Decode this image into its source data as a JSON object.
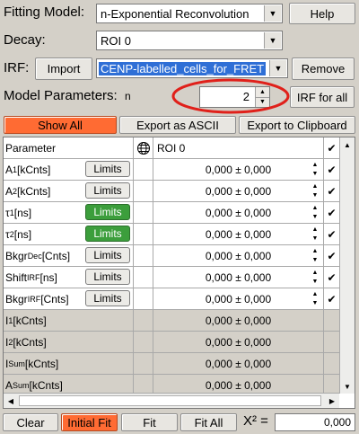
{
  "fitting_model": {
    "label": "Fitting Model:",
    "value": "n-Exponential Reconvolution",
    "help": "Help"
  },
  "decay": {
    "label": "Decay:",
    "value": "ROI 0"
  },
  "irf": {
    "label": "IRF:",
    "import": "Import",
    "value": "CENP-labelled_cells_for_FRET",
    "remove": "Remove"
  },
  "model_params": {
    "label": "Model Parameters:",
    "n_label": "n",
    "n_value": "2",
    "irf_for_all": "IRF for all"
  },
  "toolbar": {
    "show_all": "Show All",
    "export_ascii": "Export as ASCII",
    "export_clipboard": "Export to Clipboard"
  },
  "table": {
    "header_param": "Parameter",
    "header_roi": "ROI 0",
    "header_check": "✔",
    "rows": [
      {
        "name": "A",
        "sub": "1",
        "unit": "[kCnts]",
        "limits": "Limits",
        "limits_active": false,
        "value": "0,000 ± 0,000",
        "editable": true
      },
      {
        "name": "A",
        "sub": "2",
        "unit": "[kCnts]",
        "limits": "Limits",
        "limits_active": false,
        "value": "0,000 ± 0,000",
        "editable": true
      },
      {
        "name": "τ",
        "sub": "1",
        "unit": "[ns]",
        "limits": "Limits",
        "limits_active": true,
        "value": "0,000 ± 0,000",
        "editable": true
      },
      {
        "name": "τ",
        "sub": "2",
        "unit": "[ns]",
        "limits": "Limits",
        "limits_active": true,
        "value": "0,000 ± 0,000",
        "editable": true
      },
      {
        "name": "Bkgr",
        "sub": "Dec",
        "unit": "[Cnts]",
        "limits": "Limits",
        "limits_active": false,
        "value": "0,000 ± 0,000",
        "editable": true
      },
      {
        "name": "Shift",
        "sub": "IRF",
        "unit": "[ns]",
        "limits": "Limits",
        "limits_active": false,
        "value": "0,000 ± 0,000",
        "editable": true
      },
      {
        "name": "Bkgr",
        "sub": "IRF",
        "unit": "[Cnts]",
        "limits": "Limits",
        "limits_active": false,
        "value": "0,000 ± 0,000",
        "editable": true
      },
      {
        "name": "I",
        "sub": "1",
        "unit": "[kCnts]",
        "limits": "",
        "limits_active": false,
        "value": "0,000 ± 0,000",
        "editable": false
      },
      {
        "name": "I",
        "sub": "2",
        "unit": "[kCnts]",
        "limits": "",
        "limits_active": false,
        "value": "0,000 ± 0,000",
        "editable": false
      },
      {
        "name": "I",
        "sub": "Sum",
        "unit": "[kCnts]",
        "limits": "",
        "limits_active": false,
        "value": "0,000 ± 0,000",
        "editable": false
      },
      {
        "name": "A",
        "sub": "Sum",
        "unit": "[kCnts]",
        "limits": "",
        "limits_active": false,
        "value": "0,000 ± 0,000",
        "editable": false
      }
    ]
  },
  "bottom": {
    "clear": "Clear",
    "initial_fit": "Initial Fit",
    "fit": "Fit",
    "fit_all": "Fit All",
    "chi_label": "X² =",
    "chi_value": "0,000"
  },
  "colors": {
    "accent_orange": "#ff6b33",
    "limits_green": "#3c9e3c",
    "highlight_blue": "#2f6fd6",
    "annotation_red": "#e0201a"
  }
}
